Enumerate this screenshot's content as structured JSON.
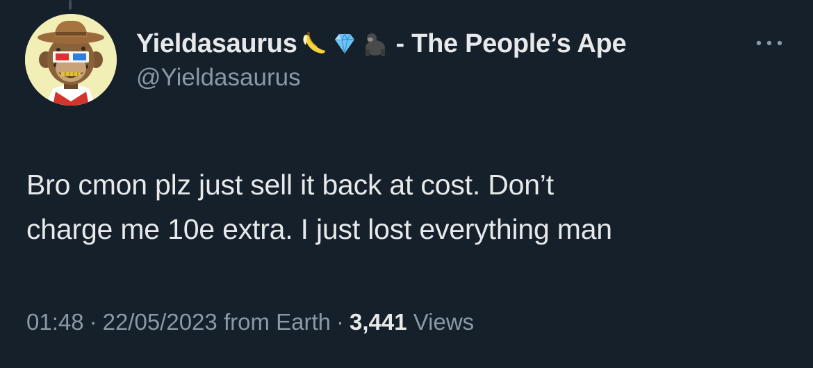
{
  "tweet": {
    "author": {
      "display_name": "Yieldasaurus",
      "name_emojis": [
        "banana-icon",
        "gem-icon",
        "gorilla-icon"
      ],
      "name_suffix": "- The People’s Ape",
      "handle": "@Yieldasaurus",
      "avatar": "bored-ape-avatar"
    },
    "text_lines": [
      "Bro cmon plz just sell it back at cost. Don’t",
      "charge me 10e extra. I just lost everything man"
    ],
    "meta": {
      "time": "01:48",
      "separator": "·",
      "date": "22/05/2023",
      "source": "from Earth",
      "views_count": "3,441",
      "views_label": "Views"
    },
    "more_icon": "more-horizontal-icon"
  },
  "colors": {
    "background": "#15202b",
    "primary_text": "#e7e9ea",
    "secondary_text": "#8b98a5"
  }
}
